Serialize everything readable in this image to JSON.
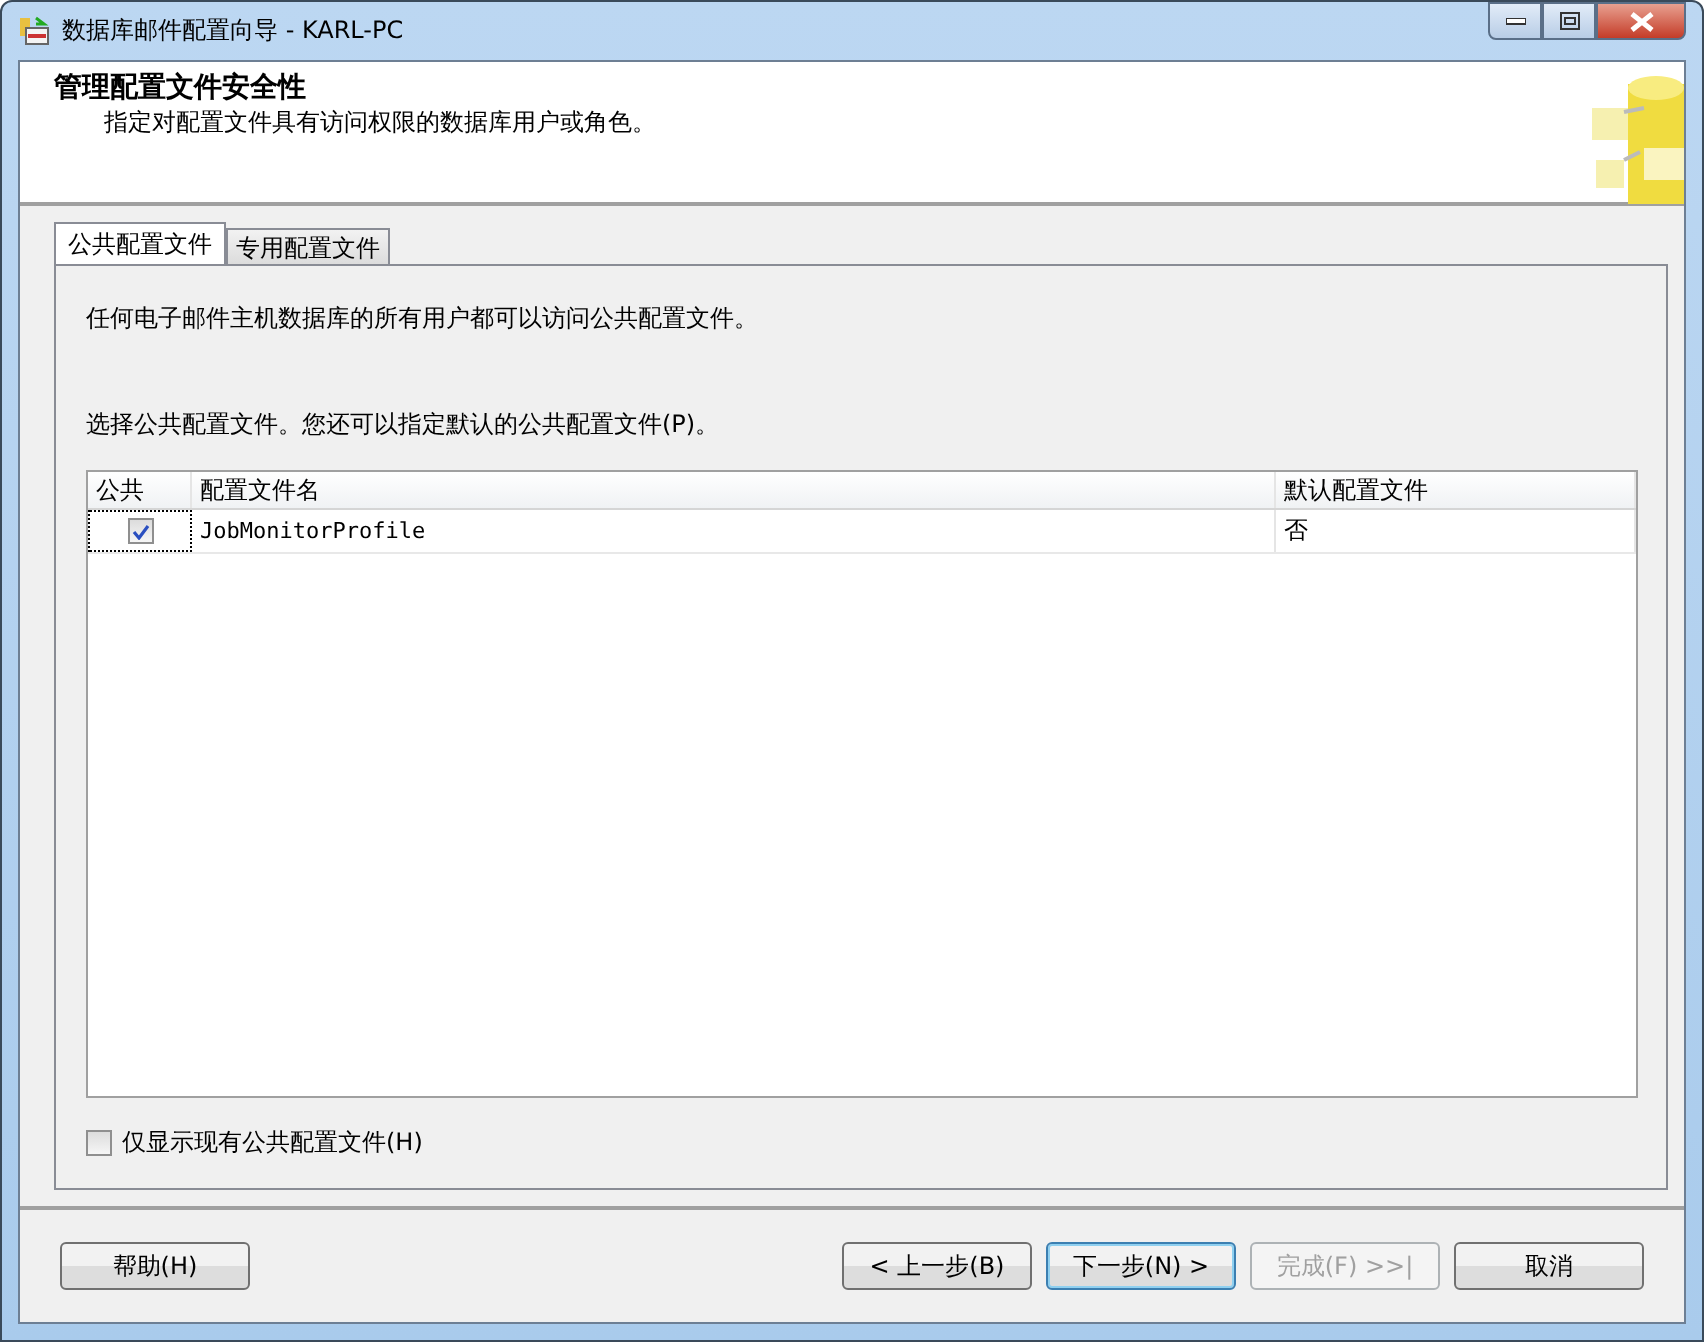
{
  "window": {
    "title": "数据库邮件配置向导 - KARL-PC"
  },
  "header": {
    "title": "管理配置文件安全性",
    "subtitle": "指定对配置文件具有访问权限的数据库用户或角色。"
  },
  "tabs": [
    {
      "label": "公共配置文件",
      "selected": true
    },
    {
      "label": "专用配置文件",
      "selected": false
    }
  ],
  "description": "任何电子邮件主机数据库的所有用户都可以访问公共配置文件。",
  "instruction": "选择公共配置文件。您还可以指定默认的公共配置文件(P)。",
  "table": {
    "columns": [
      "公共",
      "配置文件名",
      "默认配置文件"
    ],
    "rows": [
      {
        "checked": true,
        "name": "JobMonitorProfile",
        "default": "否"
      }
    ]
  },
  "show_existing": {
    "label": "仅显示现有公共配置文件(H)",
    "checked": false
  },
  "buttons": [
    {
      "label": "帮助(H)",
      "disabled": false,
      "default": false
    },
    {
      "label": "< 上一步(B)",
      "disabled": false,
      "default": false
    },
    {
      "label": "下一步(N) >",
      "disabled": false,
      "default": true
    },
    {
      "label": "完成(F) >>|",
      "disabled": true,
      "default": false
    },
    {
      "label": "取消",
      "disabled": false,
      "default": false
    }
  ]
}
